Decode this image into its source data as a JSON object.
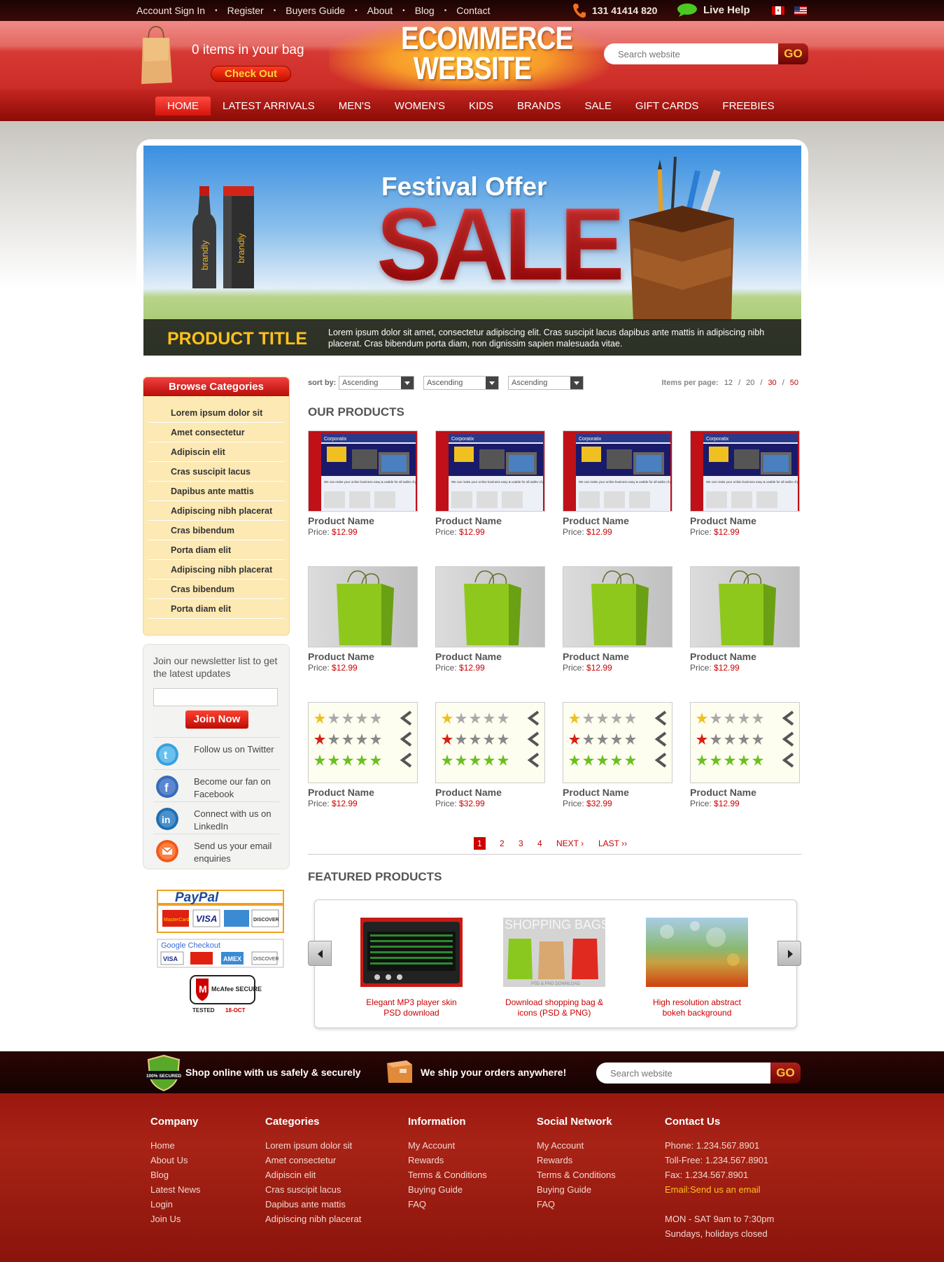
{
  "topbar": {
    "links": [
      "Account Sign In",
      "Register",
      "Buyers Guide",
      "About",
      "Blog",
      "Contact"
    ],
    "separator": "•",
    "phone": "131 41414 820",
    "live_help": "Live Help"
  },
  "header": {
    "bag_text": "0 items in your bag",
    "checkout": "Check Out",
    "logo_line1": "ECOMMERCE",
    "logo_line2": "WEBSITE",
    "search_placeholder": "Search website",
    "search_go": "GO"
  },
  "nav": [
    "HOME",
    "LATEST ARRIVALS",
    "MEN'S",
    "WOMEN'S",
    "KIDS",
    "BRANDS",
    "SALE",
    "GIFT CARDS",
    "FREEBIES"
  ],
  "banner": {
    "headline": "Festival Offer",
    "big": "SALE",
    "bottle_label": "brandly",
    "title": "PRODUCT TITLE",
    "description": "Lorem ipsum dolor sit amet, consectetur adipiscing elit. Cras suscipit lacus dapibus ante mattis in adipiscing nibh placerat. Cras bibendum porta diam, non dignissim sapien malesuada vitae."
  },
  "sidebar": {
    "title": "Browse Categories",
    "categories": [
      "Lorem ipsum dolor sit",
      "Amet consectetur",
      "Adipiscin elit",
      "Cras suscipit lacus",
      "Dapibus ante mattis",
      "Adipiscing nibh placerat",
      "Cras bibendum",
      "Porta diam elit",
      "Adipiscing nibh placerat",
      "Cras bibendum",
      "Porta diam elit"
    ],
    "newsletter_text": "Join our newsletter list to get the latest updates",
    "join": "Join Now",
    "social": [
      {
        "icon": "twitter-icon",
        "text": "Follow us on Twitter",
        "color": "#3aa0dc"
      },
      {
        "icon": "facebook-icon",
        "text": "Become our fan on Facebook",
        "color": "#3a6ab8"
      },
      {
        "icon": "linkedin-icon",
        "text": "Connect with us on LinkedIn",
        "color": "#1f6fb0"
      },
      {
        "icon": "email-icon",
        "text": "Send us your email enquiries",
        "color": "#f0581c"
      }
    ],
    "paypal": "PayPal",
    "google_checkout": "Google Checkout",
    "card_labels": [
      "MasterCard",
      "VISA",
      "AMEX",
      "DISCOVER"
    ],
    "mcafee": "McAfee SECURE",
    "mcafee_tested": "TESTED",
    "mcafee_date": "18-OCT"
  },
  "sort": {
    "label": "sort by:",
    "options": [
      "Ascending",
      "Ascending",
      "Ascending"
    ],
    "per_page_label": "Items per page:",
    "per_page": [
      "12",
      "20",
      "30",
      "50"
    ]
  },
  "products_heading": "OUR PRODUCTS",
  "product_image_text": {
    "brand": "Corporatix",
    "tagline": "We can make your online business easy & usable for all walks of people"
  },
  "products": [
    {
      "name": "Product Name",
      "price_label": "Price:",
      "price": "$12.99",
      "img": "website"
    },
    {
      "name": "Product Name",
      "price_label": "Price:",
      "price": "$12.99",
      "img": "website"
    },
    {
      "name": "Product Name",
      "price_label": "Price:",
      "price": "$12.99",
      "img": "website"
    },
    {
      "name": "Product Name",
      "price_label": "Price:",
      "price": "$12.99",
      "img": "website"
    },
    {
      "name": "Product Name",
      "price_label": "Price:",
      "price": "$12.99",
      "img": "bag"
    },
    {
      "name": "Product Name",
      "price_label": "Price:",
      "price": "$12.99",
      "img": "bag"
    },
    {
      "name": "Product Name",
      "price_label": "Price:",
      "price": "$12.99",
      "img": "bag"
    },
    {
      "name": "Product Name",
      "price_label": "Price:",
      "price": "$12.99",
      "img": "bag"
    },
    {
      "name": "Product Name",
      "price_label": "Price:",
      "price": "$12.99",
      "img": "stars"
    },
    {
      "name": "Product Name",
      "price_label": "Price:",
      "price": "$32.99",
      "img": "stars"
    },
    {
      "name": "Product Name",
      "price_label": "Price:",
      "price": "$32.99",
      "img": "stars"
    },
    {
      "name": "Product Name",
      "price_label": "Price:",
      "price": "$12.99",
      "img": "stars"
    }
  ],
  "pagination": {
    "pages": [
      "1",
      "2",
      "3",
      "4"
    ],
    "next": "NEXT ›",
    "last": "LAST ››"
  },
  "featured_heading": "FEATURED PRODUCTS",
  "featured": [
    {
      "title": "Elegant MP3 player skin PSD download"
    },
    {
      "title": "Download shopping bag & icons (PSD & PNG)",
      "img_text": "SHOPPING BAGS",
      "img_caption": "PSD & PNG DOWNLOAD"
    },
    {
      "title": "High resolution abstract bokeh background"
    }
  ],
  "footer_strip": {
    "badge": "100% SECURED",
    "secure": "Shop online with us safely & securely",
    "ship": "We ship your orders anywhere!",
    "search_placeholder": "Search website",
    "go": "GO"
  },
  "footer": {
    "company": {
      "title": "Company",
      "items": [
        "Home",
        "About Us",
        "Blog",
        "Latest News",
        "Login",
        "Join Us"
      ]
    },
    "categories": {
      "title": "Categories",
      "items": [
        "Lorem ipsum dolor sit",
        "Amet consectetur",
        "Adipiscin elit",
        "Cras suscipit lacus",
        "Dapibus ante mattis",
        "Adipiscing nibh placerat"
      ]
    },
    "information": {
      "title": "Information",
      "items": [
        "My Account",
        "Rewards",
        "Terms & Conditions",
        "Buying Guide",
        "FAQ"
      ]
    },
    "social": {
      "title": "Social Network",
      "items": [
        "My Account",
        "Rewards",
        "Terms & Conditions",
        "Buying Guide",
        "FAQ"
      ]
    },
    "contact": {
      "title": "Contact Us",
      "phone": "Phone: 1.234.567.8901",
      "tollfree": "Toll-Free: 1.234.567.8901",
      "fax": "Fax: 1.234.567.8901",
      "email": "Email:Send us an email",
      "hours1": "MON - SAT 9am to 7:30pm",
      "hours2": "Sundays, holidays closed"
    }
  },
  "colors": {
    "accent": "#cc1a12",
    "gold": "#ffc21a",
    "price": "#cc0000"
  }
}
